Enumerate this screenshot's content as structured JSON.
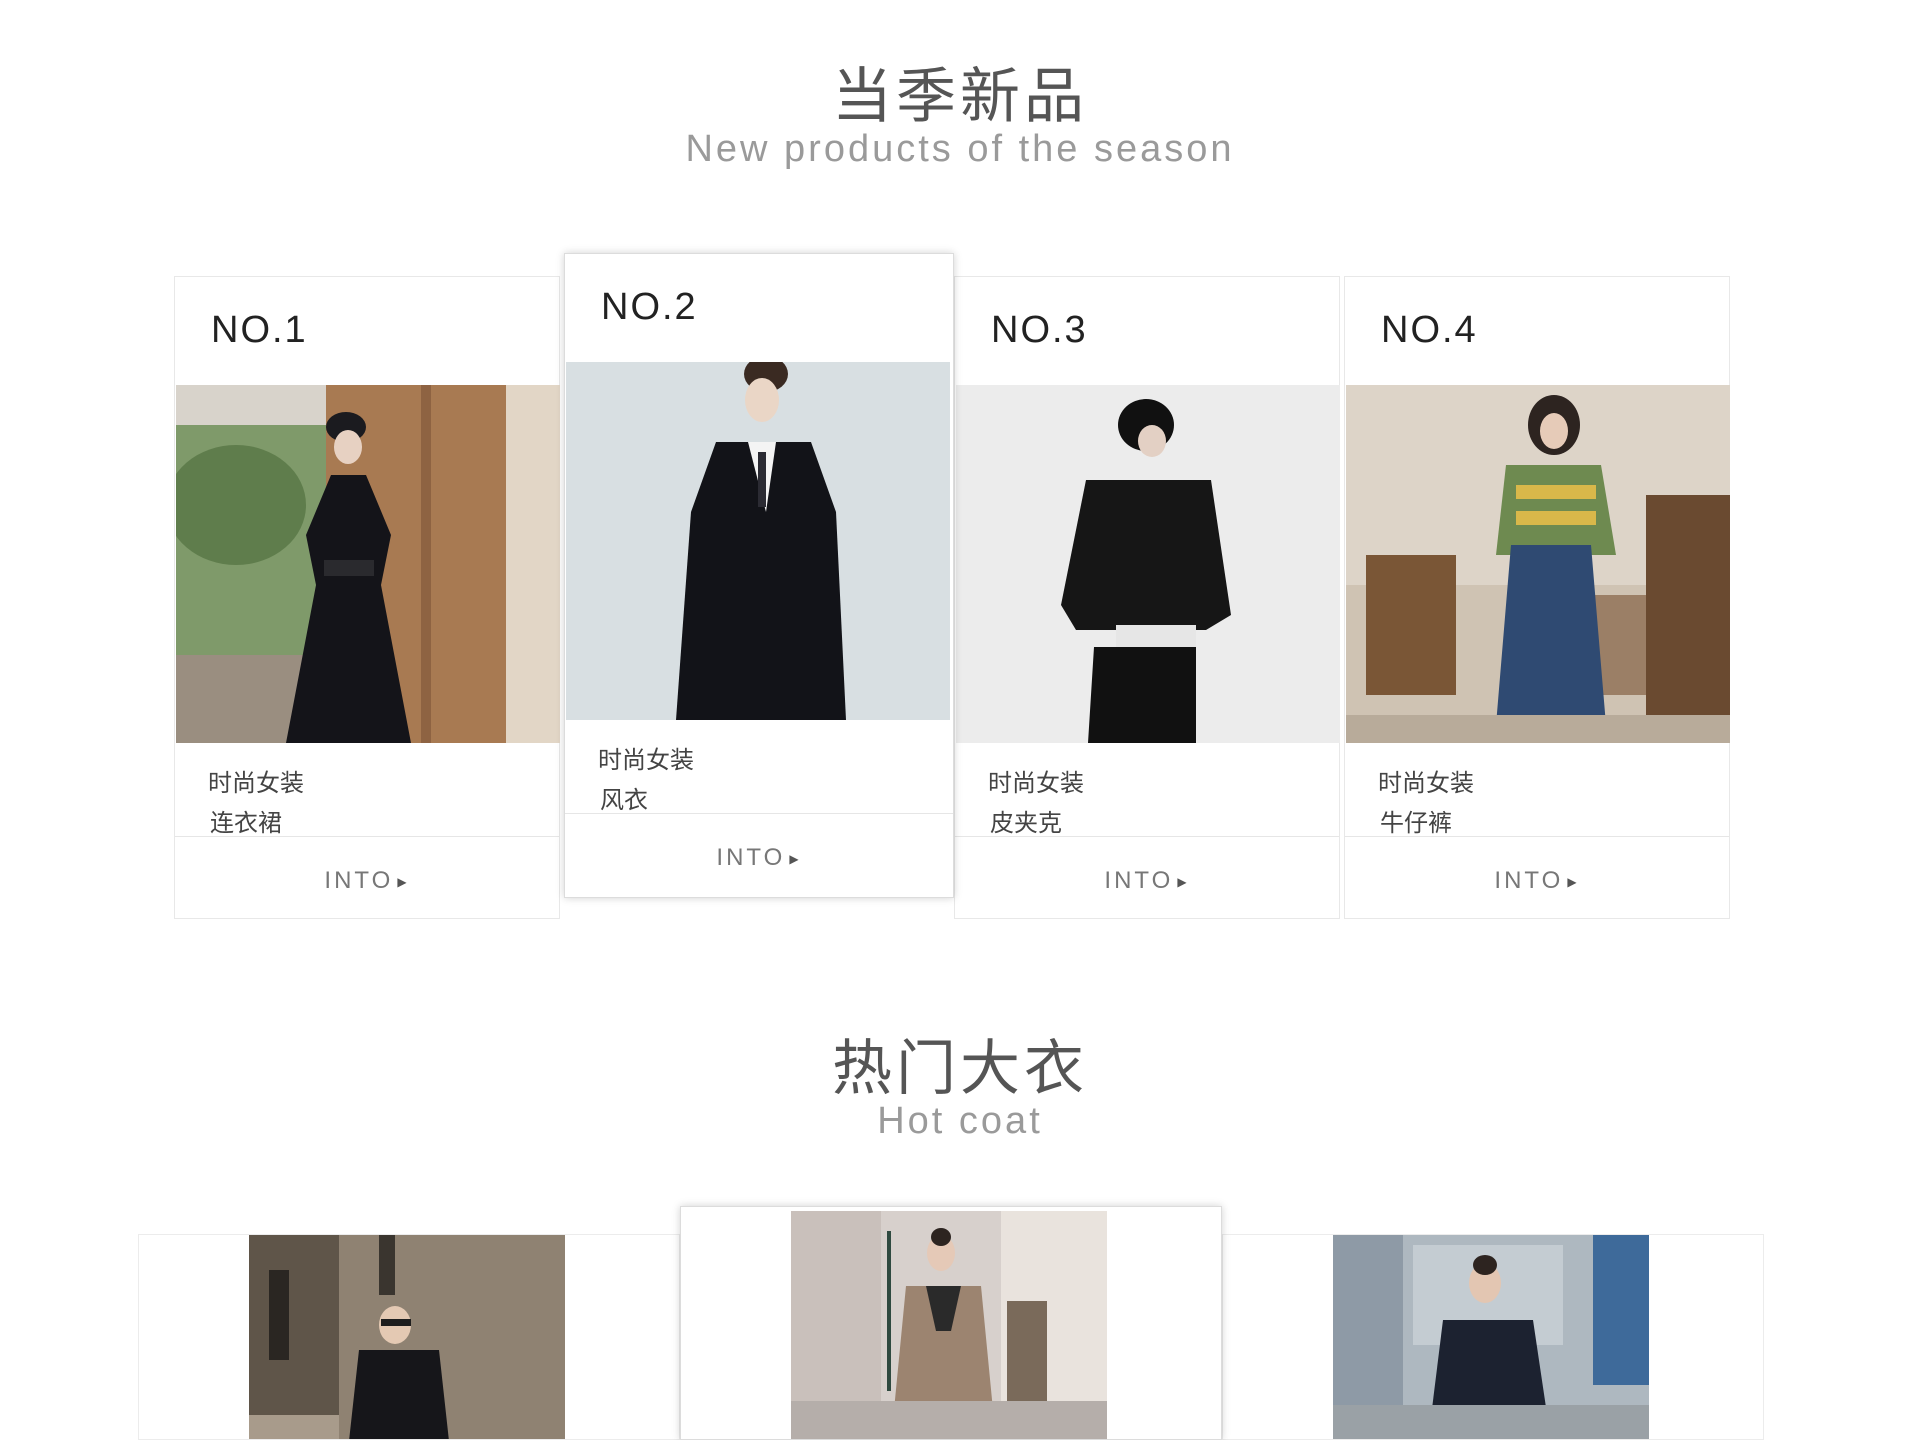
{
  "new_section": {
    "title_cn": "当季新品",
    "title_en": "New products of the season"
  },
  "products": [
    {
      "number": "NO.1",
      "category": "时尚女装",
      "name": "连衣裙",
      "link": "INTO",
      "photo": "woman-in-black-dress-photo"
    },
    {
      "number": "NO.2",
      "category": "时尚女装",
      "name": "风衣",
      "link": "INTO",
      "photo": "woman-in-black-trench-coat-photo"
    },
    {
      "number": "NO.3",
      "category": "时尚女装",
      "name": "皮夹克",
      "link": "INTO",
      "photo": "woman-in-leather-jacket-photo"
    },
    {
      "number": "NO.4",
      "category": "时尚女装",
      "name": "牛仔裤",
      "link": "INTO",
      "photo": "woman-in-denim-skirt-photo"
    }
  ],
  "hot_section": {
    "title_cn": "热门大衣",
    "title_en": "Hot coat"
  },
  "hot_coats": [
    {
      "photo": "woman-black-coat-street-photo"
    },
    {
      "photo": "woman-belted-coat-street-photo"
    },
    {
      "photo": "woman-navy-coat-street-photo"
    }
  ],
  "colors": {
    "title_cn": "#555555",
    "title_en": "#9a9a9a",
    "card_border": "#e8e8e8"
  }
}
